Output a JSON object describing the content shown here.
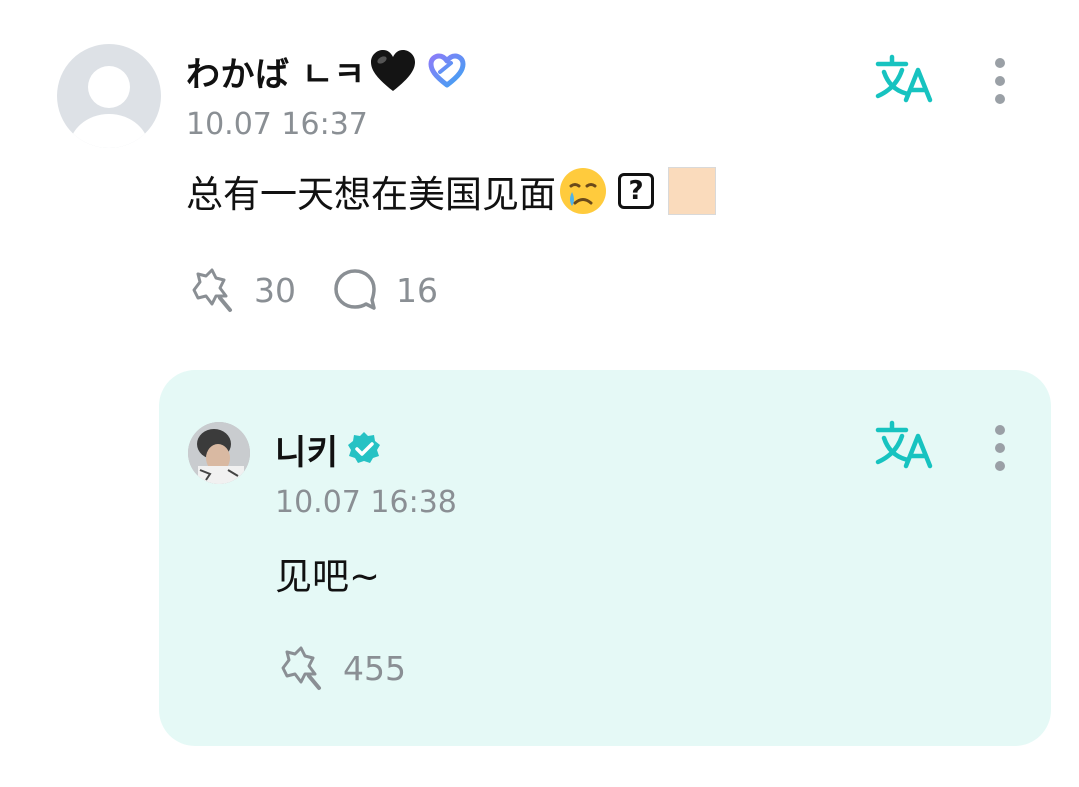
{
  "comment": {
    "username": "わかば ㄴㅋ",
    "timestamp": "10.07 16:37",
    "text": "总有一天想在美国见面",
    "emoji_question": "?",
    "like_count": "30",
    "reply_count": "16",
    "icons": [
      "avatar-placeholder",
      "black-heart-icon",
      "purple-heart-badge-icon",
      "crying-face-icon",
      "question-box-icon",
      "skin-tone-swatch",
      "translate-icon",
      "more-icon",
      "like-icon",
      "comment-icon"
    ]
  },
  "reply": {
    "username": "니키",
    "timestamp": "10.07 16:38",
    "text": "见吧~",
    "like_count": "455",
    "icons": [
      "verified-badge-icon",
      "translate-icon",
      "more-icon",
      "like-icon"
    ]
  },
  "colors": {
    "accent": "#17c3c0",
    "reply_bg": "#e5f9f6",
    "muted_text": "#8a8f94",
    "heart_purple": "#7b6cf6"
  }
}
